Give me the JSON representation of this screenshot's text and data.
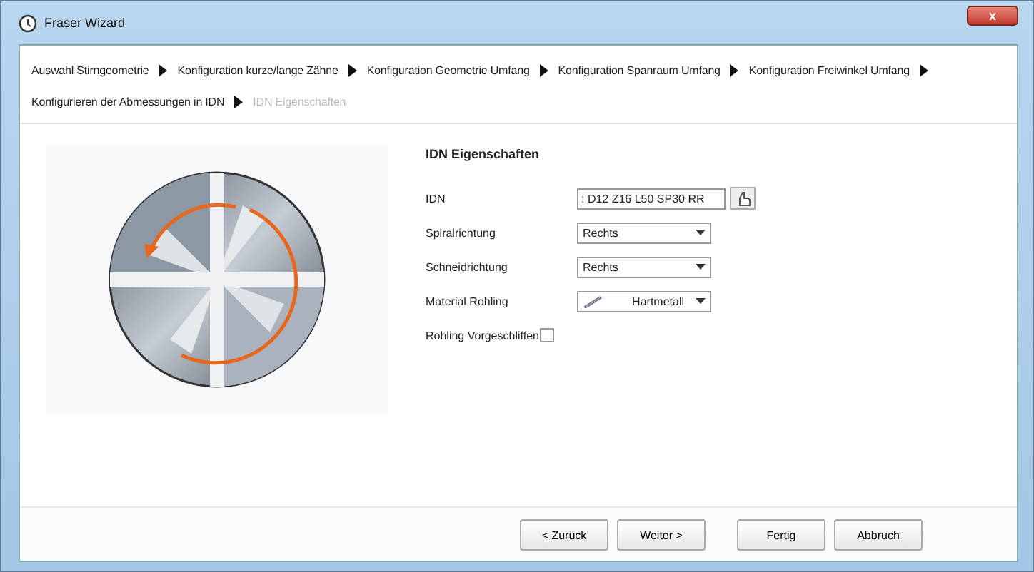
{
  "window": {
    "title": "Fräser Wizard",
    "close": "x"
  },
  "steps": [
    {
      "label": "Auswahl Stirngeometrie",
      "current": false
    },
    {
      "label": "Konfiguration kurze/lange Zähne",
      "current": false
    },
    {
      "label": "Konfiguration Geometrie Umfang",
      "current": false
    },
    {
      "label": "Konfiguration Spanraum Umfang",
      "current": false
    },
    {
      "label": "Konfiguration Freiwinkel Umfang",
      "current": false
    },
    {
      "label": "Konfigurieren der Abmessungen in IDN",
      "current": false
    },
    {
      "label": "IDN Eigenschaften",
      "current": true
    }
  ],
  "form": {
    "title": "IDN Eigenschaften",
    "fields": [
      {
        "kind": "text",
        "label": "IDN",
        "value": ": D12 Z16 L50 SP30 RR"
      },
      {
        "kind": "select",
        "label": "Spiralrichtung",
        "value": "Rechts"
      },
      {
        "kind": "select",
        "label": "Schneidrichtung",
        "value": "Rechts"
      },
      {
        "kind": "material",
        "label": "Material Rohling",
        "value": "Hartmetall"
      },
      {
        "kind": "checkbox",
        "label": "Rohling Vorgeschliffen",
        "checked": false
      }
    ]
  },
  "buttons": [
    "< Zurück",
    "Weiter >",
    "Fertig",
    "Abbruch"
  ]
}
